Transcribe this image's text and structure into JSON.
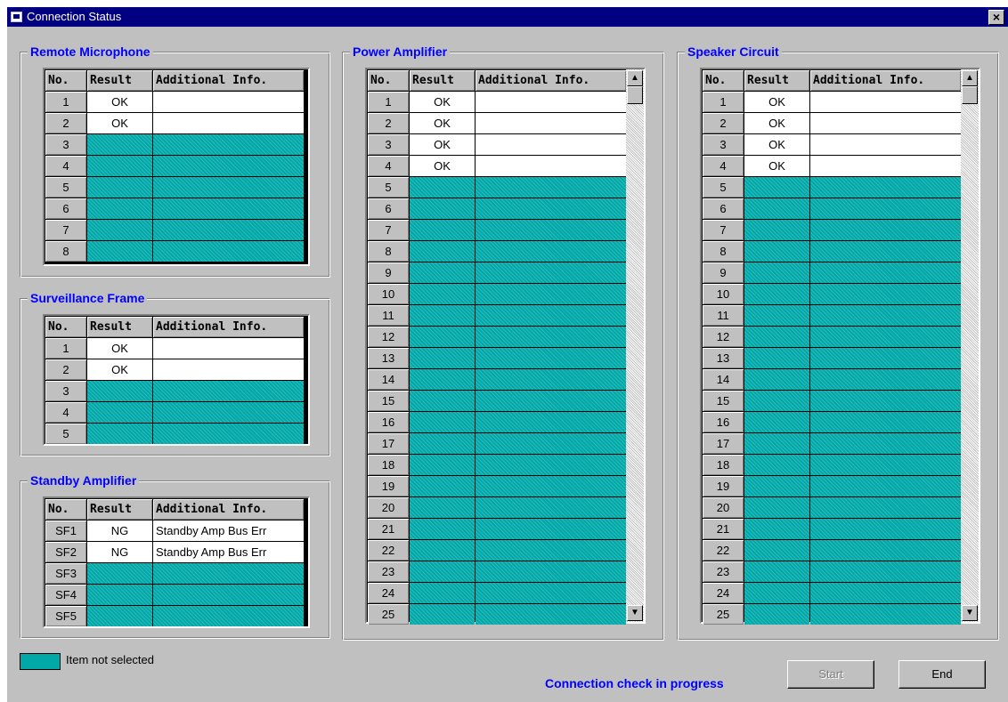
{
  "window": {
    "title": "Connection Status",
    "close_label": "×"
  },
  "headers": {
    "no": "No.",
    "result": "Result",
    "info": "Additional Info."
  },
  "groups": {
    "remote_microphone": {
      "title": "Remote Microphone",
      "rows": [
        {
          "no": "1",
          "result": "OK",
          "info": "",
          "selected": true
        },
        {
          "no": "2",
          "result": "OK",
          "info": "",
          "selected": true
        },
        {
          "no": "3",
          "result": "",
          "info": "",
          "selected": false
        },
        {
          "no": "4",
          "result": "",
          "info": "",
          "selected": false
        },
        {
          "no": "5",
          "result": "",
          "info": "",
          "selected": false
        },
        {
          "no": "6",
          "result": "",
          "info": "",
          "selected": false
        },
        {
          "no": "7",
          "result": "",
          "info": "",
          "selected": false
        },
        {
          "no": "8",
          "result": "",
          "info": "",
          "selected": false
        }
      ]
    },
    "surveillance_frame": {
      "title": "Surveillance Frame",
      "rows": [
        {
          "no": "1",
          "result": "OK",
          "info": "",
          "selected": true
        },
        {
          "no": "2",
          "result": "OK",
          "info": "",
          "selected": true
        },
        {
          "no": "3",
          "result": "",
          "info": "",
          "selected": false
        },
        {
          "no": "4",
          "result": "",
          "info": "",
          "selected": false
        },
        {
          "no": "5",
          "result": "",
          "info": "",
          "selected": false
        }
      ]
    },
    "standby_amplifier": {
      "title": "Standby Amplifier",
      "rows": [
        {
          "no": "SF1",
          "result": "NG",
          "info": "Standby Amp Bus Err",
          "selected": true
        },
        {
          "no": "SF2",
          "result": "NG",
          "info": "Standby Amp Bus Err",
          "selected": true
        },
        {
          "no": "SF3",
          "result": "",
          "info": "",
          "selected": false
        },
        {
          "no": "SF4",
          "result": "",
          "info": "",
          "selected": false
        },
        {
          "no": "SF5",
          "result": "",
          "info": "",
          "selected": false
        }
      ]
    },
    "power_amplifier": {
      "title": "Power Amplifier",
      "rows": [
        {
          "no": "1",
          "result": "OK",
          "info": "",
          "selected": true
        },
        {
          "no": "2",
          "result": "OK",
          "info": "",
          "selected": true
        },
        {
          "no": "3",
          "result": "OK",
          "info": "",
          "selected": true
        },
        {
          "no": "4",
          "result": "OK",
          "info": "",
          "selected": true
        },
        {
          "no": "5",
          "result": "",
          "info": "",
          "selected": false
        },
        {
          "no": "6",
          "result": "",
          "info": "",
          "selected": false
        },
        {
          "no": "7",
          "result": "",
          "info": "",
          "selected": false
        },
        {
          "no": "8",
          "result": "",
          "info": "",
          "selected": false
        },
        {
          "no": "9",
          "result": "",
          "info": "",
          "selected": false
        },
        {
          "no": "10",
          "result": "",
          "info": "",
          "selected": false
        },
        {
          "no": "11",
          "result": "",
          "info": "",
          "selected": false
        },
        {
          "no": "12",
          "result": "",
          "info": "",
          "selected": false
        },
        {
          "no": "13",
          "result": "",
          "info": "",
          "selected": false
        },
        {
          "no": "14",
          "result": "",
          "info": "",
          "selected": false
        },
        {
          "no": "15",
          "result": "",
          "info": "",
          "selected": false
        },
        {
          "no": "16",
          "result": "",
          "info": "",
          "selected": false
        },
        {
          "no": "17",
          "result": "",
          "info": "",
          "selected": false
        },
        {
          "no": "18",
          "result": "",
          "info": "",
          "selected": false
        },
        {
          "no": "19",
          "result": "",
          "info": "",
          "selected": false
        },
        {
          "no": "20",
          "result": "",
          "info": "",
          "selected": false
        },
        {
          "no": "21",
          "result": "",
          "info": "",
          "selected": false
        },
        {
          "no": "22",
          "result": "",
          "info": "",
          "selected": false
        },
        {
          "no": "23",
          "result": "",
          "info": "",
          "selected": false
        },
        {
          "no": "24",
          "result": "",
          "info": "",
          "selected": false
        },
        {
          "no": "25",
          "result": "",
          "info": "",
          "selected": false
        }
      ]
    },
    "speaker_circuit": {
      "title": "Speaker Circuit",
      "rows": [
        {
          "no": "1",
          "result": "OK",
          "info": "",
          "selected": true
        },
        {
          "no": "2",
          "result": "OK",
          "info": "",
          "selected": true
        },
        {
          "no": "3",
          "result": "OK",
          "info": "",
          "selected": true
        },
        {
          "no": "4",
          "result": "OK",
          "info": "",
          "selected": true
        },
        {
          "no": "5",
          "result": "",
          "info": "",
          "selected": false
        },
        {
          "no": "6",
          "result": "",
          "info": "",
          "selected": false
        },
        {
          "no": "7",
          "result": "",
          "info": "",
          "selected": false
        },
        {
          "no": "8",
          "result": "",
          "info": "",
          "selected": false
        },
        {
          "no": "9",
          "result": "",
          "info": "",
          "selected": false
        },
        {
          "no": "10",
          "result": "",
          "info": "",
          "selected": false
        },
        {
          "no": "11",
          "result": "",
          "info": "",
          "selected": false
        },
        {
          "no": "12",
          "result": "",
          "info": "",
          "selected": false
        },
        {
          "no": "13",
          "result": "",
          "info": "",
          "selected": false
        },
        {
          "no": "14",
          "result": "",
          "info": "",
          "selected": false
        },
        {
          "no": "15",
          "result": "",
          "info": "",
          "selected": false
        },
        {
          "no": "16",
          "result": "",
          "info": "",
          "selected": false
        },
        {
          "no": "17",
          "result": "",
          "info": "",
          "selected": false
        },
        {
          "no": "18",
          "result": "",
          "info": "",
          "selected": false
        },
        {
          "no": "19",
          "result": "",
          "info": "",
          "selected": false
        },
        {
          "no": "20",
          "result": "",
          "info": "",
          "selected": false
        },
        {
          "no": "21",
          "result": "",
          "info": "",
          "selected": false
        },
        {
          "no": "22",
          "result": "",
          "info": "",
          "selected": false
        },
        {
          "no": "23",
          "result": "",
          "info": "",
          "selected": false
        },
        {
          "no": "24",
          "result": "",
          "info": "",
          "selected": false
        },
        {
          "no": "25",
          "result": "",
          "info": "",
          "selected": false
        }
      ]
    }
  },
  "legend": {
    "label": "Item not selected"
  },
  "status": {
    "text": "Connection check in progress"
  },
  "buttons": {
    "start": "Start",
    "end": "End"
  },
  "icons": {
    "scroll_up": "scroll-up-arrow-icon",
    "scroll_down": "scroll-down-arrow-icon",
    "window": "window-icon"
  },
  "colors": {
    "titlebar": "#000080",
    "group_title": "#0000ff",
    "not_selected": "#00a8a8",
    "face": "#c0c0c0"
  }
}
